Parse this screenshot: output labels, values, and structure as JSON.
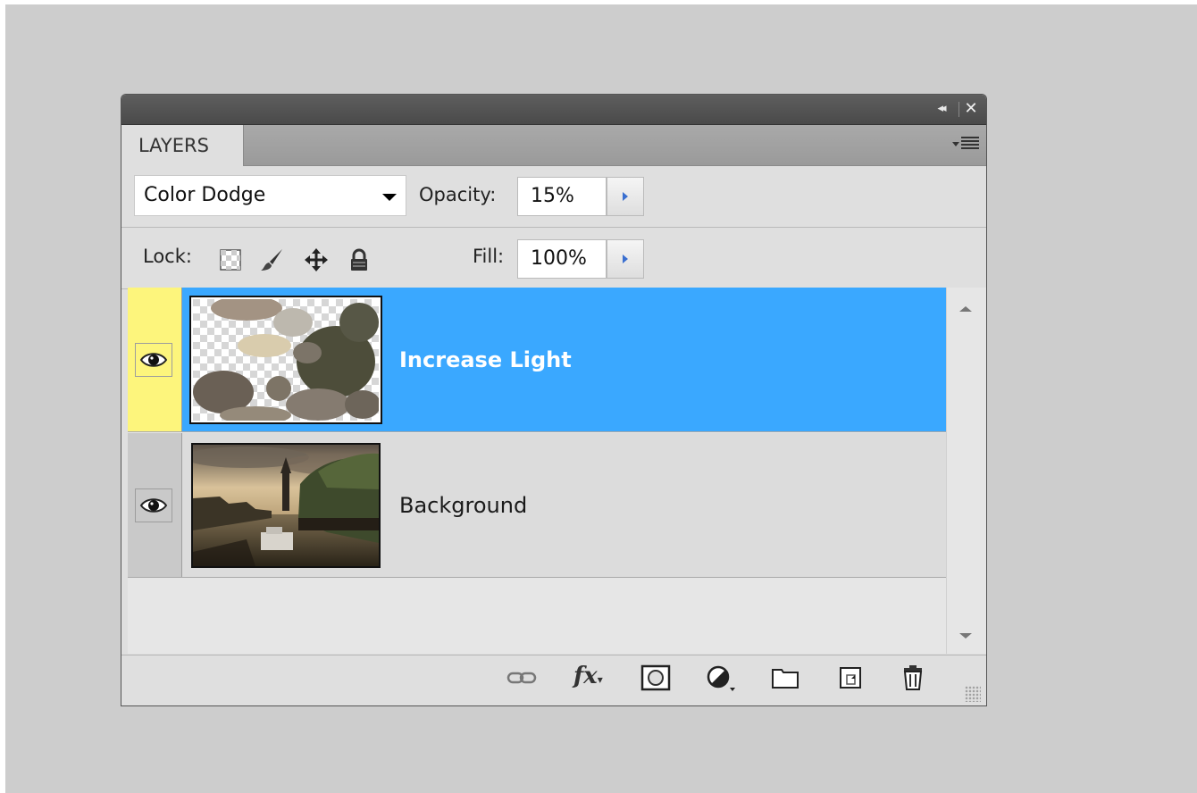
{
  "panel": {
    "title": "LAYERS",
    "collapse_glyph": "◂◂",
    "close_glyph": "✕",
    "menu_icon": "panel-menu-icon"
  },
  "blend": {
    "mode": "Color Dodge",
    "opacity_label": "Opacity:",
    "opacity_value": "15%"
  },
  "lock": {
    "label": "Lock:",
    "icons": [
      "lock-transparent-pixels-icon",
      "lock-image-pixels-icon",
      "lock-position-icon",
      "lock-all-icon"
    ],
    "fill_label": "Fill:",
    "fill_value": "100%"
  },
  "layers": [
    {
      "name": "Increase Light",
      "selected": true,
      "visible": true
    },
    {
      "name": "Background",
      "selected": false,
      "visible": true
    }
  ],
  "bottom_icons": [
    "link-layers-icon",
    "fx-icon",
    "layer-mask-icon",
    "adjustment-layer-icon",
    "new-group-icon",
    "new-layer-icon",
    "delete-layer-icon"
  ],
  "bottom": {
    "fx_label": "fx"
  },
  "colors": {
    "selection": "#3aa8ff",
    "visibility_highlight": "#fdf57c",
    "panel": "#dfdfdf"
  }
}
